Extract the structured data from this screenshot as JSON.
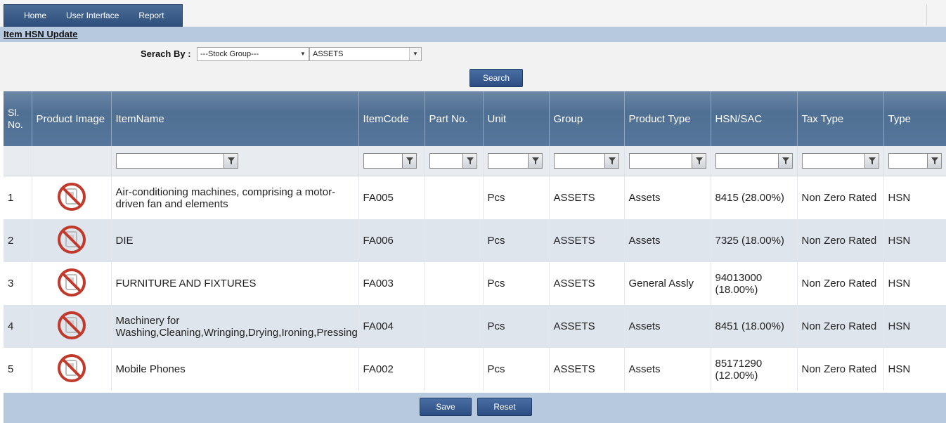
{
  "menu": {
    "items": [
      {
        "label": "Home"
      },
      {
        "label": "User Interface"
      },
      {
        "label": "Report"
      }
    ]
  },
  "page": {
    "title": "Item HSN Update"
  },
  "search": {
    "label": "Serach By :",
    "by_value": "---Stock Group---",
    "group_value": "ASSETS",
    "button_label": "Search"
  },
  "table": {
    "headers": {
      "sl": "Sl. No.",
      "image": "Product Image",
      "item_name": "ItemName",
      "item_code": "ItemCode",
      "part_no": "Part No.",
      "unit": "Unit",
      "group": "Group",
      "product_type": "Product Type",
      "hsn": "HSN/SAC",
      "tax_type": "Tax Type",
      "type": "Type"
    },
    "rows": [
      {
        "sl": "1",
        "item_name": "Air-conditioning machines, comprising a motor-driven fan and elements",
        "item_code": "FA005",
        "part_no": "",
        "unit": "Pcs",
        "group": "ASSETS",
        "product_type": "Assets",
        "hsn": "8415 (28.00%)",
        "tax_type": "Non Zero Rated",
        "type": "HSN"
      },
      {
        "sl": "2",
        "item_name": "DIE",
        "item_code": "FA006",
        "part_no": "",
        "unit": "Pcs",
        "group": "ASSETS",
        "product_type": "Assets",
        "hsn": "7325 (18.00%)",
        "tax_type": "Non Zero Rated",
        "type": "HSN"
      },
      {
        "sl": "3",
        "item_name": "FURNITURE AND FIXTURES",
        "item_code": "FA003",
        "part_no": "",
        "unit": "Pcs",
        "group": "ASSETS",
        "product_type": "General Assly",
        "hsn": "94013000 (18.00%)",
        "tax_type": "Non Zero Rated",
        "type": "HSN"
      },
      {
        "sl": "4",
        "item_name": "Machinery for Washing,Cleaning,Wringing,Drying,Ironing,Pressing",
        "item_code": "FA004",
        "part_no": "",
        "unit": "Pcs",
        "group": "ASSETS",
        "product_type": "Assets",
        "hsn": "8451 (18.00%)",
        "tax_type": "Non Zero Rated",
        "type": "HSN"
      },
      {
        "sl": "5",
        "item_name": "Mobile Phones",
        "item_code": "FA002",
        "part_no": "",
        "unit": "Pcs",
        "group": "ASSETS",
        "product_type": "Assets",
        "hsn": "85171290 (12.00%)",
        "tax_type": "Non Zero Rated",
        "type": "HSN"
      }
    ]
  },
  "footer": {
    "save_label": "Save",
    "reset_label": "Reset"
  },
  "colors": {
    "header": "#56779b",
    "band": "#b7c9df",
    "button": "#2c4d82",
    "no_image": "#c0392b"
  }
}
